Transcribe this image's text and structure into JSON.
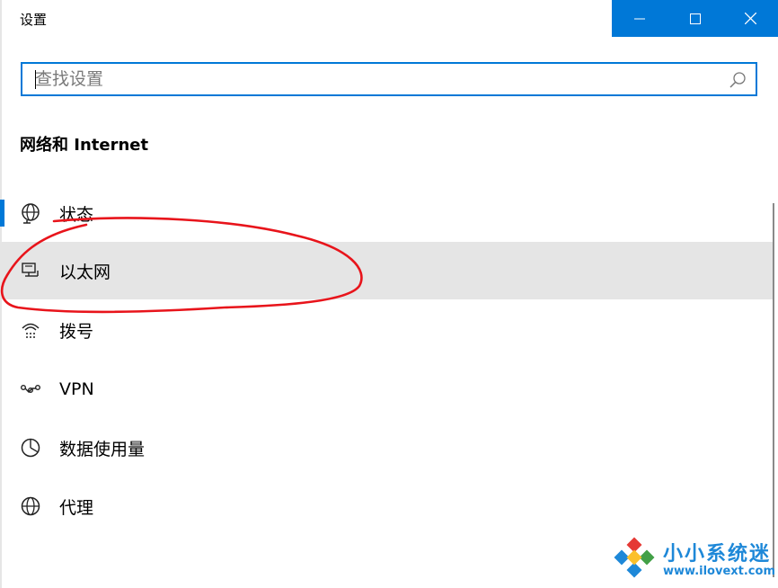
{
  "window": {
    "title": "设置",
    "minimize_glyph": "—",
    "maximize_glyph": "☐",
    "close_glyph": "✕"
  },
  "search": {
    "placeholder": "查找设置",
    "value": ""
  },
  "section": {
    "title": "网络和 Internet"
  },
  "nav": {
    "items": [
      {
        "label": "状态",
        "icon": "globe-status-icon"
      },
      {
        "label": "以太网",
        "icon": "ethernet-icon"
      },
      {
        "label": "拨号",
        "icon": "dialup-icon"
      },
      {
        "label": "VPN",
        "icon": "vpn-icon"
      },
      {
        "label": "数据使用量",
        "icon": "data-usage-icon"
      },
      {
        "label": "代理",
        "icon": "globe-proxy-icon"
      }
    ],
    "selected_index": 0,
    "highlighted_index": 1
  },
  "watermark": {
    "name": "小小系统迷",
    "url": "www.ilovext.com"
  },
  "colors": {
    "accent": "#0078d7",
    "highlight": "#e5e5e5",
    "annotation": "#e8141b",
    "watermark": "#1e88d8"
  }
}
